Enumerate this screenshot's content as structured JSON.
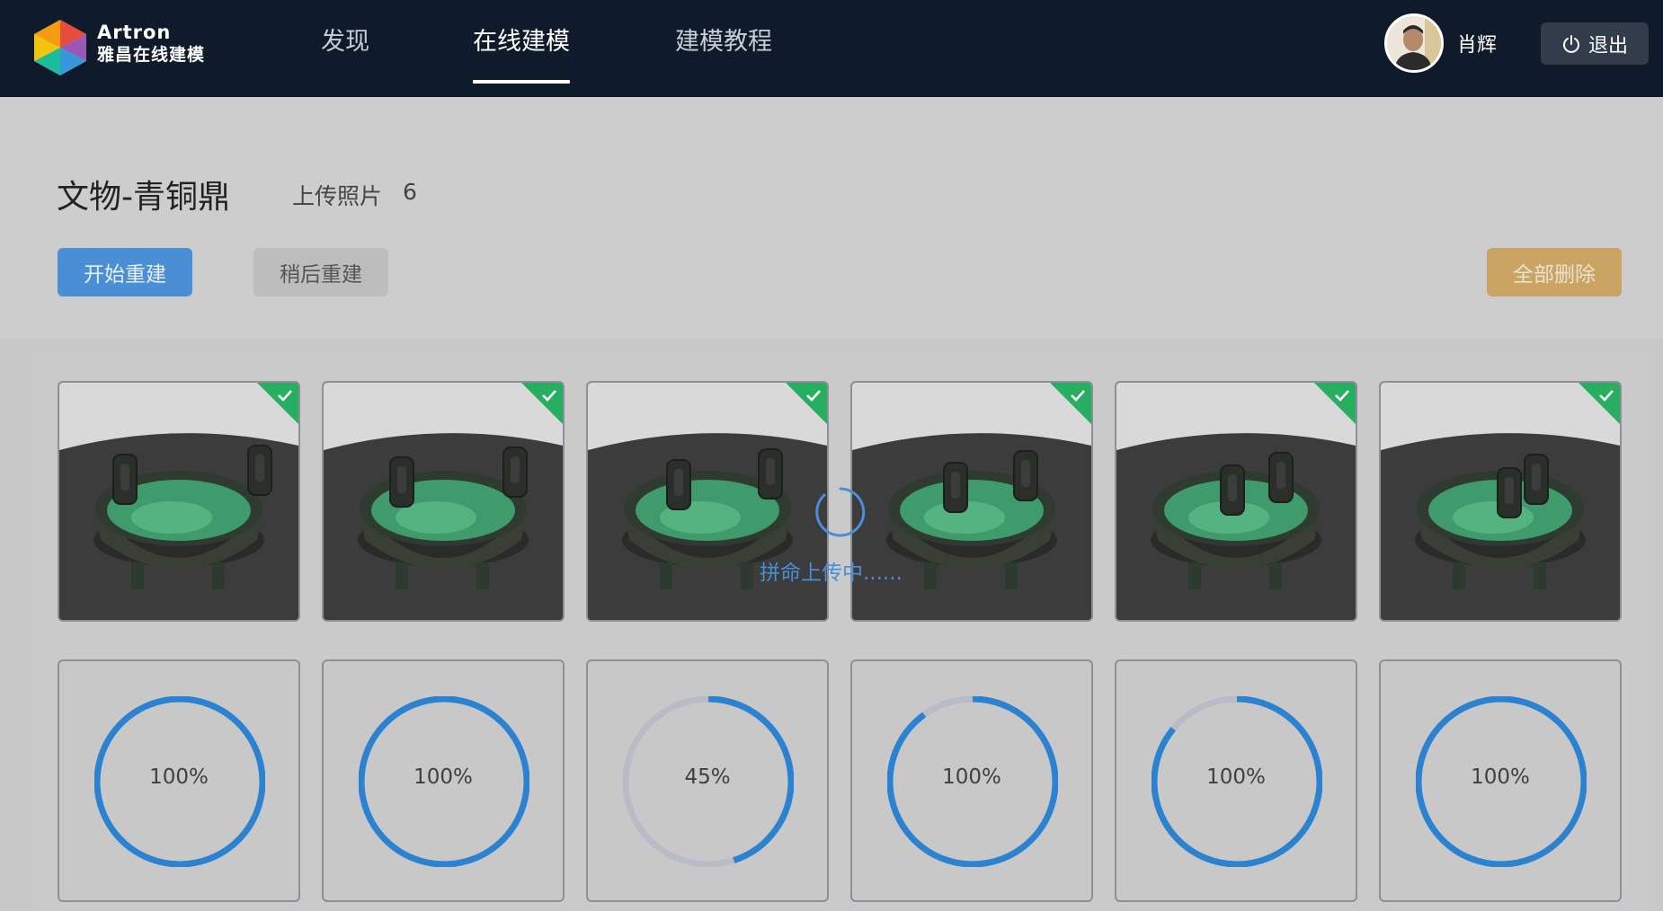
{
  "header": {
    "logo_line1": "Artron",
    "logo_line2": "雅昌在线建模",
    "nav": [
      {
        "label": "发现"
      },
      {
        "label": "在线建模"
      },
      {
        "label": "建模教程"
      }
    ],
    "active_nav": "在线建模",
    "username": "肖辉",
    "logout_label": "退出"
  },
  "project": {
    "title": "文物-青铜鼎",
    "upload_label": "上传照片",
    "upload_count": "6"
  },
  "actions": {
    "start_label": "开始重建",
    "later_label": "稍后重建",
    "delete_all_label": "全部删除"
  },
  "overlay": {
    "loading_text": "拼命上传中......"
  },
  "photos": [
    {
      "uploaded": true
    },
    {
      "uploaded": true
    },
    {
      "uploaded": true
    },
    {
      "uploaded": true
    },
    {
      "uploaded": true
    },
    {
      "uploaded": true
    }
  ],
  "progress": [
    {
      "label": "100%",
      "value": 1.0
    },
    {
      "label": "100%",
      "value": 1.0
    },
    {
      "label": "45%",
      "value": 0.45
    },
    {
      "label": "100%",
      "value": 0.9
    },
    {
      "label": "100%",
      "value": 0.86
    },
    {
      "label": "100%",
      "value": 1.0
    }
  ],
  "colors": {
    "header_bg": "#0f1a2a",
    "primary": "#4a8fd6",
    "warning": "#c9a463",
    "progress": "#2a82d0",
    "progress_track": "#b9bcc6",
    "check": "#27ae60"
  }
}
